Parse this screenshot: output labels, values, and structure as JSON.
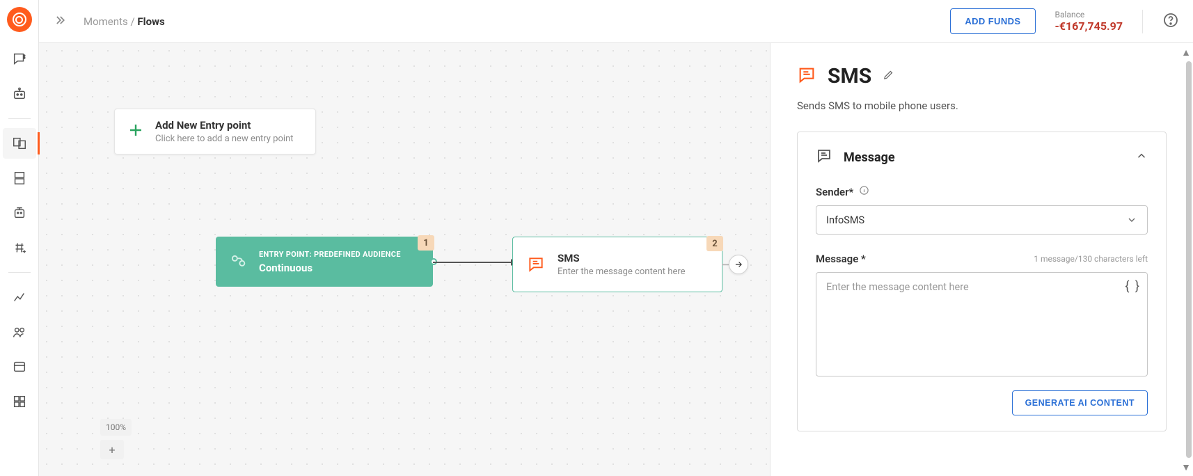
{
  "breadcrumb": {
    "parent": "Moments",
    "sep": "/",
    "current": "Flows"
  },
  "header": {
    "add_funds": "ADD FUNDS",
    "balance_label": "Balance",
    "balance_value": "-€167,745.97"
  },
  "entry_card": {
    "title": "Add New Entry point",
    "subtitle": "Click here to add a new entry point"
  },
  "node_entry": {
    "label": "ENTRY POINT: PREDEFINED AUDIENCE",
    "value": "Continuous",
    "badge": "1"
  },
  "node_sms": {
    "title": "SMS",
    "subtitle": "Enter the message content here",
    "badge": "2"
  },
  "zoom": {
    "level": "100%"
  },
  "panel": {
    "title": "SMS",
    "description": "Sends SMS to mobile phone users.",
    "section_title": "Message",
    "sender_label": "Sender*",
    "sender_value": "InfoSMS",
    "message_label": "Message *",
    "message_hint": "1 message/130 characters left",
    "message_placeholder": "Enter the message content here",
    "generate_ai": "GENERATE AI CONTENT"
  }
}
